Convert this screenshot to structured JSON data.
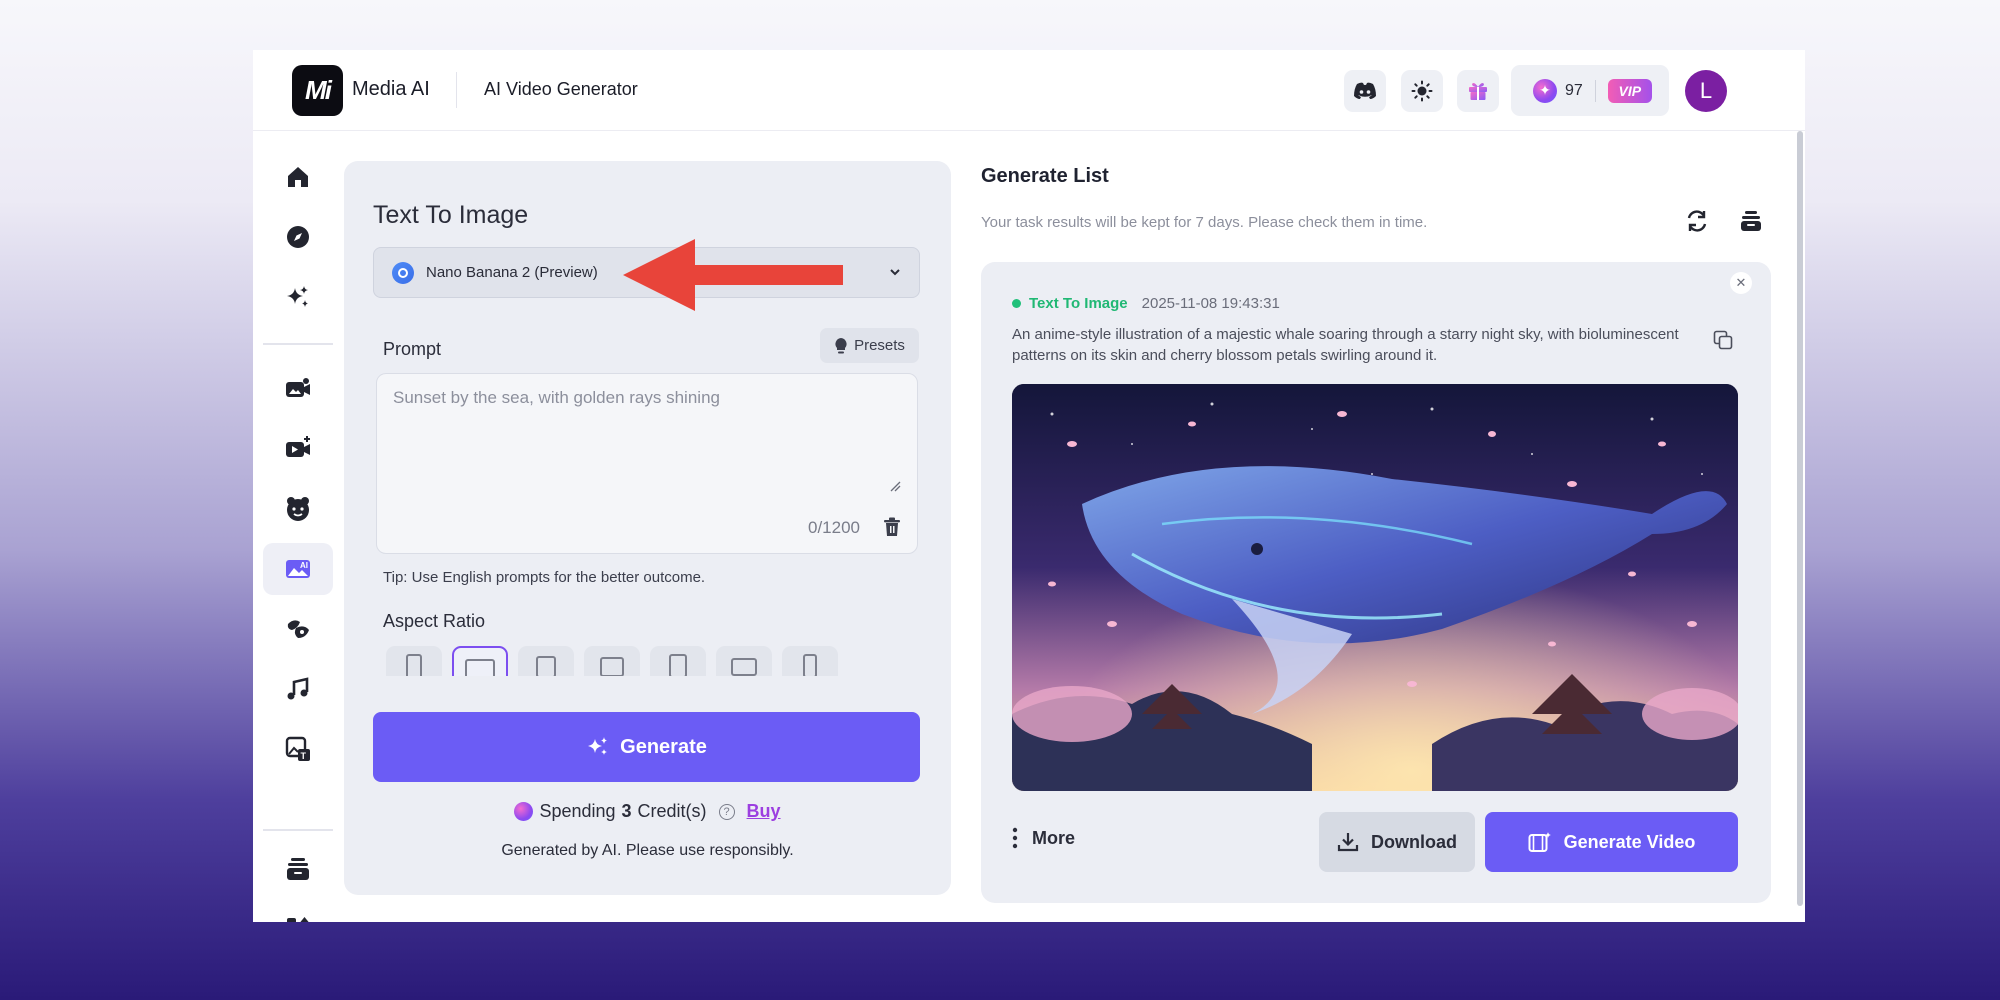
{
  "header": {
    "logo_text": "Mi",
    "brand": "Media AI",
    "page_name": "AI Video Generator",
    "credits": "97",
    "vip_label": "VIP",
    "avatar_initial": "L"
  },
  "sidebar": {
    "items": [
      {
        "icon": "home-icon"
      },
      {
        "icon": "compass-icon"
      },
      {
        "icon": "sparkles-icon"
      },
      {
        "icon": "image-to-video-icon"
      },
      {
        "icon": "video-camera-icon"
      },
      {
        "icon": "avatar-face-icon"
      },
      {
        "icon": "ai-image-icon",
        "active": true
      },
      {
        "icon": "effects-icon"
      },
      {
        "icon": "music-icon"
      },
      {
        "icon": "image-text-icon"
      },
      {
        "icon": "stack-icon"
      },
      {
        "icon": "apps-icon"
      }
    ]
  },
  "panel": {
    "title": "Text To Image",
    "model": "Nano Banana 2 (Preview)",
    "prompt_label": "Prompt",
    "presets_label": "Presets",
    "prompt_value": "",
    "prompt_placeholder": "Sunset by the sea, with golden rays shining",
    "counter": "0/1200",
    "tip": "Tip: Use English prompts for the better outcome.",
    "aspect_ratio_label": "Aspect Ratio",
    "generate_label": "Generate",
    "spending_prefix": "Spending",
    "spending_amount": "3",
    "spending_suffix": "Credit(s)",
    "buy_label": "Buy",
    "disclaimer": "Generated by AI. Please use responsibly."
  },
  "generate_list": {
    "title": "Generate List",
    "subtitle": "Your task results will be kept for 7 days. Please check them in time.",
    "card": {
      "type": "Text To Image",
      "timestamp": "2025-11-08 19:43:31",
      "description": "An anime-style illustration of a majestic whale soaring through a starry night sky, with bioluminescent patterns on its skin and cherry blossom petals swirling around it.",
      "more_label": "More",
      "download_label": "Download",
      "generate_video_label": "Generate Video"
    }
  },
  "colors": {
    "accent": "#6b5cf5",
    "status_green": "#20b874",
    "buy": "#9c3fe0",
    "arrow": "#e8443a"
  }
}
